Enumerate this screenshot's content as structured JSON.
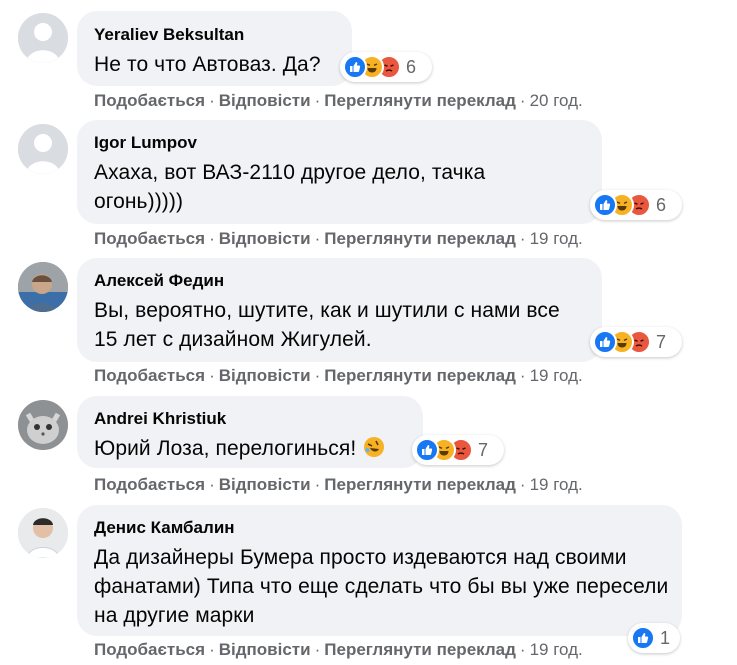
{
  "comments": [
    {
      "author": "Yeraliev Beksultan",
      "text": "Не то что Автоваз. Да?",
      "reaction_count": "6",
      "actions": {
        "like": "Подобається",
        "reply": "Відповісти",
        "translate": "Переглянути переклад",
        "time": "20 год."
      }
    },
    {
      "author": "Igor Lumpov",
      "text": "Ахаха, вот ВАЗ-2110 другое дело, тачка огонь)))))",
      "reaction_count": "6",
      "actions": {
        "like": "Подобається",
        "reply": "Відповісти",
        "translate": "Переглянути переклад",
        "time": "19 год."
      }
    },
    {
      "author": "Алексей Федин",
      "text": "Вы, вероятно, шутите, как и шутили с нами все 15 лет с дизайном Жигулей.",
      "reaction_count": "7",
      "actions": {
        "like": "Подобається",
        "reply": "Відповісти",
        "translate": "Переглянути переклад",
        "time": "19 год."
      }
    },
    {
      "author": "Andrei Khristiuk",
      "text": "Юрий Лоза, перелогинься!",
      "reaction_count": "7",
      "actions": {
        "like": "Подобається",
        "reply": "Відповісти",
        "translate": "Переглянути переклад",
        "time": "19 год."
      }
    },
    {
      "author": "Денис Камбалин",
      "text": "Да дизайнеры Бумера просто издеваются над своими фанатами) Типа что еще сделать что бы вы уже пересели на другие марки",
      "reaction_count": "1",
      "actions": {
        "like": "Подобається",
        "reply": "Відповісти",
        "translate": "Переглянути переклад",
        "time": "19 год."
      }
    }
  ],
  "separator": "·",
  "colors": {
    "bubble": "#f0f2f5",
    "meta": "#65676b",
    "like": "#1877f2",
    "haha": "#f7b125",
    "angry": "#e9573e"
  },
  "icons": [
    "default-avatar-icon",
    "like-reaction-icon",
    "haha-reaction-icon",
    "angry-reaction-icon",
    "rolling-laughing-emoji-icon"
  ]
}
